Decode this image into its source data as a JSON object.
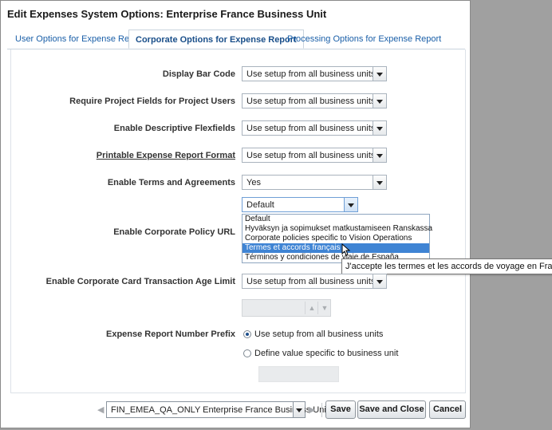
{
  "dialog": {
    "title": "Edit Expenses System Options: Enterprise France Business Unit"
  },
  "tabs": [
    {
      "label": "User Options for Expense Report"
    },
    {
      "label": "Corporate Options for Expense Report"
    },
    {
      "label": "Processing Options for Expense Report"
    }
  ],
  "active_tab": "Corporate Options for Expense Report",
  "fields": {
    "display_bar_code": {
      "label": "Display Bar Code",
      "value": "Use setup from all business units"
    },
    "require_project_fields": {
      "label": "Require Project Fields for Project Users",
      "value": "Use setup from all business units"
    },
    "enable_descriptive_flexfields": {
      "label": "Enable Descriptive Flexfields",
      "value": "Use setup from all business units"
    },
    "printable_format": {
      "label": "Printable Expense Report Format",
      "value": "Use setup from all business units"
    },
    "enable_terms": {
      "label": "Enable Terms and Agreements",
      "value": "Yes"
    },
    "corporate_policy_url": {
      "label": "Enable Corporate Policy URL",
      "value": "Default",
      "options": [
        "Default",
        "Hyväksyn ja sopimukset matkustamiseen Ranskassa",
        "Corporate policies specific to Vision Operations",
        "Termes et accords français",
        "Términos y condiciones de viaje de España"
      ],
      "highlighted_index": 3,
      "tooltip": "J'accepte les termes et les accords de voyage en France"
    },
    "card_transaction_age": {
      "label": "Enable Corporate Card Transaction Age Limit",
      "value": "Use setup from all business units"
    },
    "number_prefix": {
      "label": "Expense Report Number Prefix",
      "options": [
        "Use setup from all business units",
        "Define value specific to business unit"
      ],
      "selected": "Use setup from all business units"
    }
  },
  "footer": {
    "business_unit": "FIN_EMEA_QA_ONLY Enterprise France Business Unit",
    "save_label": "Save",
    "save_close_label": "Save and Close",
    "cancel_label": "Cancel"
  },
  "icons": {
    "dropdown": "chevron-down-icon",
    "spinner_up": "chevron-up-icon",
    "spinner_down": "chevron-down-icon",
    "prev": "previous-icon",
    "next": "next-icon"
  },
  "colors": {
    "link": "#1a5fa8",
    "highlight": "#3f84d4",
    "overlay": "#a0a0a0"
  }
}
